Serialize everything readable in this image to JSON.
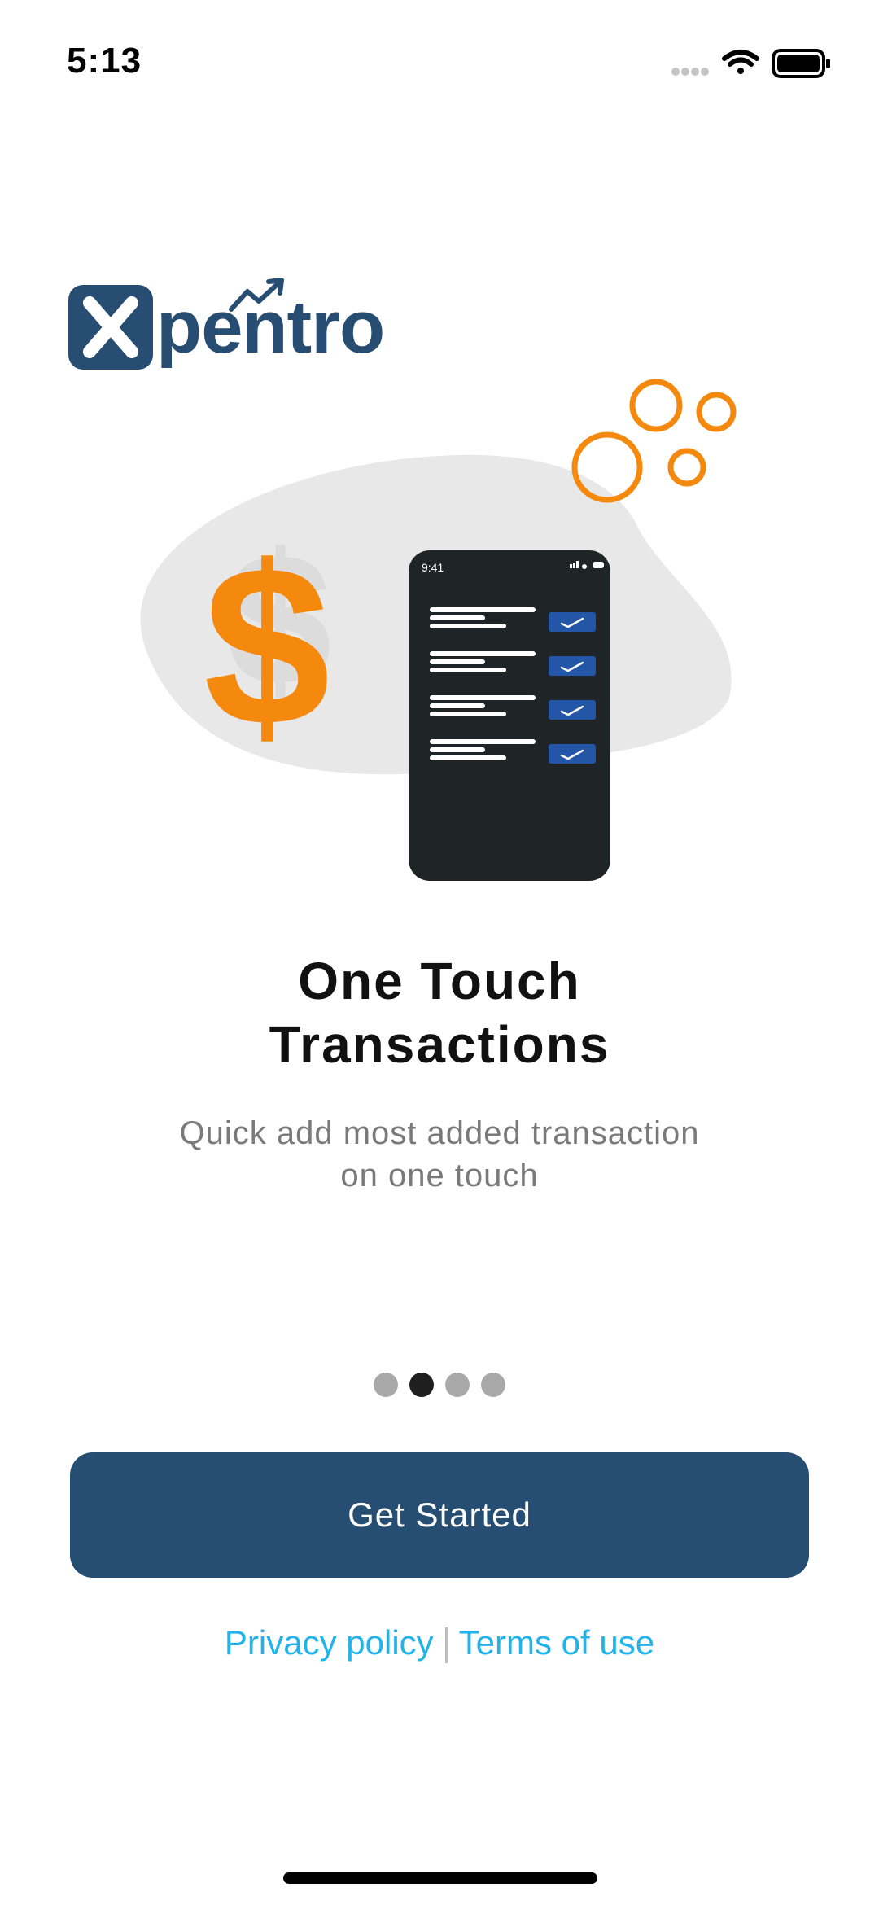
{
  "status_bar": {
    "time": "5:13",
    "icons": [
      "signal-dots-icon",
      "wifi-icon",
      "battery-icon"
    ]
  },
  "logo": {
    "text": "pentro",
    "brand_color": "#284d73"
  },
  "illustration": {
    "phone_time": "9:41",
    "currency_symbol": "$"
  },
  "onboarding": {
    "title_line1": "One Touch",
    "title_line2": "Transactions",
    "subtitle_line1": "Quick add most added transaction",
    "subtitle_line2": "on one touch",
    "pages_total": 4,
    "active_page": 2
  },
  "cta": {
    "label": "Get Started",
    "color": "#264d72"
  },
  "footer": {
    "privacy_label": "Privacy policy",
    "terms_label": "Terms of use",
    "link_color": "#21b3ea"
  },
  "colors": {
    "accent_orange": "#f5890e",
    "phone_dark": "#1f2527",
    "check_blue": "#2456a8"
  }
}
